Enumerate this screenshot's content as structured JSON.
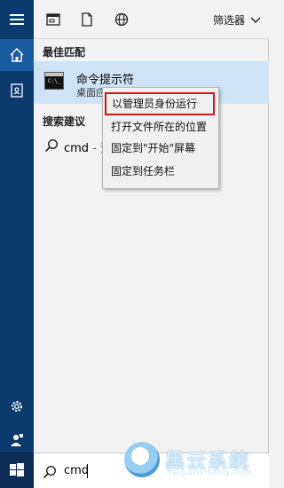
{
  "top_toolbar": {
    "filter_label": "筛选器"
  },
  "sections": {
    "best_match_title": "最佳匹配",
    "suggestions_title": "搜索建议"
  },
  "best_match": {
    "name": "命令提示符",
    "subtitle": "桌面应",
    "icon_prompt": "C:\\_"
  },
  "suggestion": {
    "query": "cmd",
    "hint": " - 查"
  },
  "context_menu": {
    "items": [
      "以管理员身份运行",
      "打开文件所在的位置",
      "固定到\"开始\"屏幕",
      "固定到任务栏"
    ],
    "highlight_color": "#d11a1a"
  },
  "search": {
    "value": "cmd"
  },
  "watermark": {
    "brand": "黑云系统",
    "url": "heiyunxitong.com"
  },
  "colors": {
    "rail": "#0a3a6e",
    "selection": "#cfe3f6"
  }
}
